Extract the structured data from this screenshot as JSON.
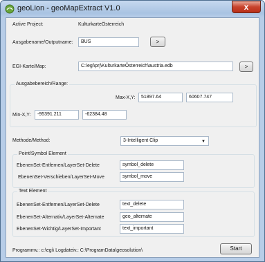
{
  "window": {
    "title": "geoLion - geoMapExtract V1.0",
    "close_glyph": "x"
  },
  "project": {
    "label": "Active Project:",
    "value": "KulturkarteÖsterreich"
  },
  "output": {
    "label": "Ausgabename/Outputname:",
    "value": "BUS",
    "button": ">"
  },
  "map": {
    "label": "EGI-Karte/Map:",
    "value": "C:\\egi\\prj\\KulturkarteÖsterreich\\austria.edb",
    "button": ">"
  },
  "range": {
    "group_title": "Ausgabebereich/Range:",
    "max_label": "Max-X,Y:",
    "max_x": "51897.64",
    "max_y": "60607.747",
    "min_label": "Min-X,Y:",
    "min_x": "-95391.211",
    "min_y": "-62384.48"
  },
  "method": {
    "label": "Methode/Method:",
    "selected": "3-Intelligent Clip"
  },
  "point_group": {
    "title": "Point/Symbol Element",
    "delete_label": "EbenenSet-Entfernen/LayerSet-Delete",
    "delete_value": "symbol_delete",
    "move_label": "EbenenSet-Verschieben/LayerSet-Move",
    "move_value": "symbol_move"
  },
  "text_group": {
    "title": "Text Element",
    "delete_label": "EbenenSet-Entfernen/LayerSet-Delete",
    "delete_value": "text_delete",
    "alternate_label": "EbenenSet-Alternativ/LayerSet-Alternate",
    "alternate_value": "geo_alternate",
    "important_label": "EbenenSet-Wichtig/LayerSet-Important",
    "important_value": "text_important"
  },
  "footer": {
    "status": "Programmv.: c:\\egi\\ Logdateiv.: C:\\ProgramData\\geosolution\\",
    "start_button": "Start"
  },
  "colors": {
    "title_bar": "#b7cde8",
    "client_bg": "#f0f0f0",
    "close_button": "#c8432c",
    "icon_green": "#6aa63c"
  }
}
